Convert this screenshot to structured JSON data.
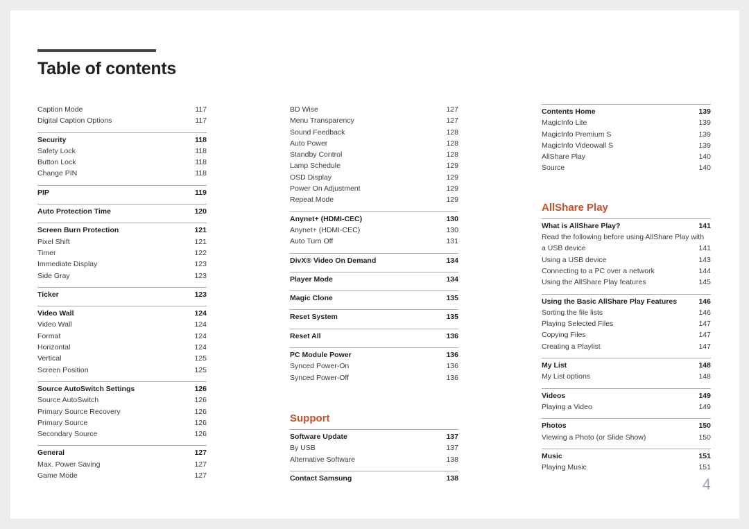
{
  "title": "Table of contents",
  "page_number": "4",
  "accent_color": "#c8502a",
  "columns": [
    {
      "sections": [
        {
          "heading": null,
          "items": [
            {
              "label": "Caption Mode",
              "page": "117"
            },
            {
              "label": "Digital Caption Options",
              "page": "117"
            }
          ]
        },
        {
          "heading": {
            "label": "Security",
            "page": "118"
          },
          "items": [
            {
              "label": "Safety Lock",
              "page": "118"
            },
            {
              "label": "Button Lock",
              "page": "118"
            },
            {
              "label": "Change PIN",
              "page": "118"
            }
          ]
        },
        {
          "heading": {
            "label": "PIP",
            "page": "119"
          },
          "items": []
        },
        {
          "heading": {
            "label": "Auto Protection Time",
            "page": "120"
          },
          "items": []
        },
        {
          "heading": {
            "label": "Screen Burn Protection",
            "page": "121"
          },
          "items": [
            {
              "label": "Pixel Shift",
              "page": "121"
            },
            {
              "label": "Timer",
              "page": "122"
            },
            {
              "label": "Immediate Display",
              "page": "123"
            },
            {
              "label": "Side Gray",
              "page": "123"
            }
          ]
        },
        {
          "heading": {
            "label": "Ticker",
            "page": "123"
          },
          "items": []
        },
        {
          "heading": {
            "label": "Video Wall",
            "page": "124"
          },
          "items": [
            {
              "label": "Video Wall",
              "page": "124"
            },
            {
              "label": "Format",
              "page": "124"
            },
            {
              "label": "Horizontal",
              "page": "124"
            },
            {
              "label": "Vertical",
              "page": "125"
            },
            {
              "label": "Screen Position",
              "page": "125"
            }
          ]
        },
        {
          "heading": {
            "label": "Source AutoSwitch Settings",
            "page": "126"
          },
          "items": [
            {
              "label": "Source AutoSwitch",
              "page": "126"
            },
            {
              "label": "Primary Source Recovery",
              "page": "126"
            },
            {
              "label": "Primary Source",
              "page": "126"
            },
            {
              "label": "Secondary Source",
              "page": "126"
            }
          ]
        },
        {
          "heading": {
            "label": "General",
            "page": "127"
          },
          "items": [
            {
              "label": "Max. Power Saving",
              "page": "127"
            },
            {
              "label": "Game Mode",
              "page": "127"
            }
          ]
        }
      ]
    },
    {
      "sections": [
        {
          "heading": null,
          "items": [
            {
              "label": "BD Wise",
              "page": "127"
            },
            {
              "label": "Menu Transparency",
              "page": "127"
            },
            {
              "label": "Sound Feedback",
              "page": "128"
            },
            {
              "label": "Auto Power",
              "page": "128"
            },
            {
              "label": "Standby Control",
              "page": "128"
            },
            {
              "label": "Lamp Schedule",
              "page": "129"
            },
            {
              "label": "OSD Display",
              "page": "129"
            },
            {
              "label": "Power On Adjustment",
              "page": "129"
            },
            {
              "label": "Repeat Mode",
              "page": "129"
            }
          ]
        },
        {
          "heading": {
            "label": "Anynet+ (HDMI-CEC)",
            "page": "130"
          },
          "items": [
            {
              "label": "Anynet+ (HDMI-CEC)",
              "page": "130"
            },
            {
              "label": "Auto Turn Off",
              "page": "131"
            }
          ]
        },
        {
          "heading": {
            "label": "DivX® Video On Demand",
            "page": "134"
          },
          "items": []
        },
        {
          "heading": {
            "label": "Player Mode",
            "page": "134"
          },
          "items": []
        },
        {
          "heading": {
            "label": "Magic Clone",
            "page": "135"
          },
          "items": []
        },
        {
          "heading": {
            "label": "Reset System",
            "page": "135"
          },
          "items": []
        },
        {
          "heading": {
            "label": "Reset All",
            "page": "136"
          },
          "items": []
        },
        {
          "heading": {
            "label": "PC Module Power",
            "page": "136"
          },
          "items": [
            {
              "label": "Synced Power-On",
              "page": "136"
            },
            {
              "label": "Synced Power-Off",
              "page": "136"
            }
          ]
        }
      ],
      "chapter": "Support",
      "chapter_sections": [
        {
          "heading": {
            "label": "Software Update",
            "page": "137"
          },
          "items": [
            {
              "label": "By USB",
              "page": "137"
            },
            {
              "label": "Alternative Software",
              "page": "138"
            }
          ]
        },
        {
          "heading": {
            "label": "Contact Samsung",
            "page": "138"
          },
          "items": []
        }
      ]
    },
    {
      "sections": [
        {
          "heading": {
            "label": "Contents Home",
            "page": "139"
          },
          "items": [
            {
              "label": "MagicInfo Lite",
              "page": "139"
            },
            {
              "label": "MagicInfo Premium S",
              "page": "139"
            },
            {
              "label": "MagicInfo Videowall S",
              "page": "139"
            },
            {
              "label": "AllShare Play",
              "page": "140"
            },
            {
              "label": "Source",
              "page": "140"
            }
          ]
        }
      ],
      "chapter": "AllShare Play",
      "chapter_sections": [
        {
          "heading": {
            "label": "What is AllShare Play?",
            "page": "141"
          },
          "items": [
            {
              "label": "Read the following before using AllShare Play with",
              "label_cont": "a USB device",
              "page": "141"
            },
            {
              "label": "Using a USB device",
              "page": "143"
            },
            {
              "label": "Connecting to a PC over a network",
              "page": "144"
            },
            {
              "label": "Using the AllShare Play features",
              "page": "145"
            }
          ]
        },
        {
          "heading": {
            "label": "Using the Basic AllShare Play Features",
            "page": "146"
          },
          "items": [
            {
              "label": "Sorting the file lists",
              "page": "146"
            },
            {
              "label": "Playing Selected Files",
              "page": "147"
            },
            {
              "label": "Copying Files",
              "page": "147"
            },
            {
              "label": "Creating a Playlist",
              "page": "147"
            }
          ]
        },
        {
          "heading": {
            "label": "My List",
            "page": "148"
          },
          "items": [
            {
              "label": "My List options",
              "page": "148"
            }
          ]
        },
        {
          "heading": {
            "label": "Videos",
            "page": "149"
          },
          "items": [
            {
              "label": "Playing a Video",
              "page": "149"
            }
          ]
        },
        {
          "heading": {
            "label": "Photos",
            "page": "150"
          },
          "items": [
            {
              "label": "Viewing a Photo (or Slide Show)",
              "page": "150"
            }
          ]
        },
        {
          "heading": {
            "label": "Music",
            "page": "151"
          },
          "items": [
            {
              "label": "Playing Music",
              "page": "151"
            }
          ]
        }
      ]
    }
  ]
}
